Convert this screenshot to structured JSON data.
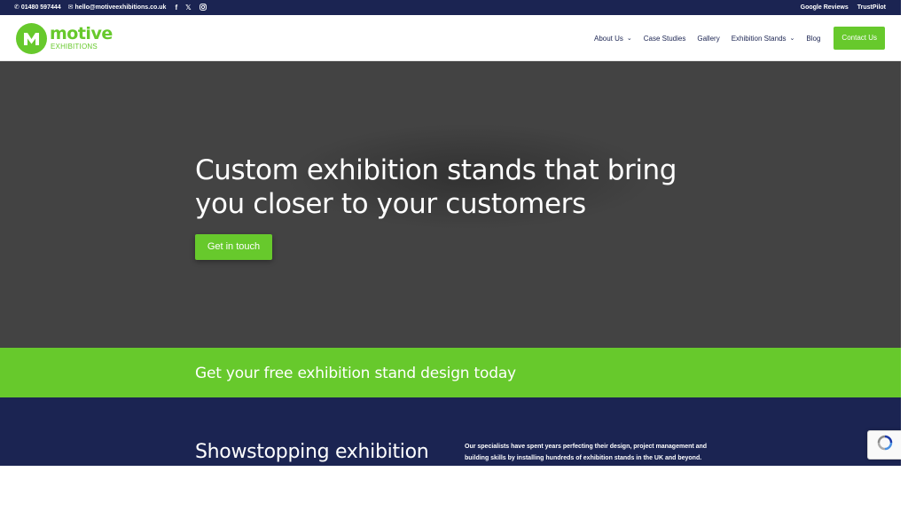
{
  "topbar": {
    "phone": "01480 597444",
    "email": "hello@motiveexhibitions.co.uk",
    "social_icons": [
      "facebook-icon",
      "x-icon",
      "instagram-icon"
    ],
    "links": [
      "Google Reviews",
      "TrustPilot"
    ]
  },
  "header": {
    "logo_word": "motive",
    "logo_sub": "EXHIBITIONS",
    "nav": [
      {
        "label": "About Us",
        "has_dropdown": true
      },
      {
        "label": "Case Studies",
        "has_dropdown": false
      },
      {
        "label": "Gallery",
        "has_dropdown": false
      },
      {
        "label": "Exhibition Stands",
        "has_dropdown": true
      },
      {
        "label": "Blog",
        "has_dropdown": false
      }
    ],
    "cta_label": "Contact Us"
  },
  "hero": {
    "title_line1": "Custom exhibition stands that bring",
    "title_line2": "you closer to your customers",
    "button_label": "Get in touch"
  },
  "banner": {
    "text": "Get your free exhibition stand design today"
  },
  "intro": {
    "heading": "Showstopping exhibition",
    "paragraph": "Our specialists have spent years perfecting their design, project management and building skills by installing hundreds of exhibition stands in the UK and beyond."
  },
  "colors": {
    "navy": "#1b2452",
    "green": "#67c92c",
    "hero_bg": "#434343"
  }
}
